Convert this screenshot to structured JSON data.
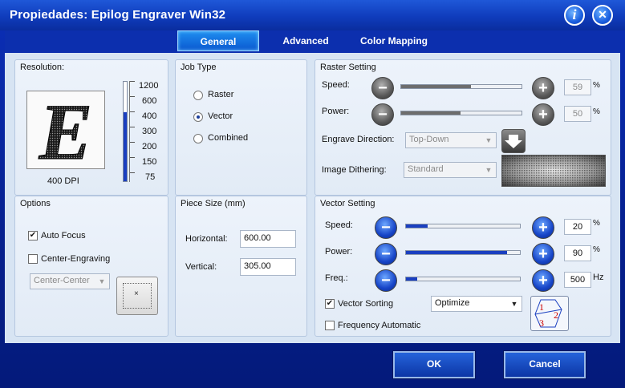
{
  "window": {
    "title": "Propiedades: Epilog Engraver Win32"
  },
  "title_buttons": {
    "info": "i",
    "close": "✕"
  },
  "tabs": [
    {
      "label": "General"
    },
    {
      "label": "Advanced"
    },
    {
      "label": "Color Mapping"
    }
  ],
  "resolution": {
    "title": "Resolution:",
    "preview_letter": "E",
    "dpi_label": "400 DPI",
    "scale": [
      "1200",
      "600",
      "400",
      "300",
      "200",
      "150",
      "75"
    ],
    "selected": "400"
  },
  "job_type": {
    "title": "Job Type",
    "options": [
      "Raster",
      "Vector",
      "Combined"
    ],
    "selected": "Vector"
  },
  "raster": {
    "title": "Raster Setting",
    "speed_label": "Speed:",
    "speed_value": "59",
    "speed_unit": "%",
    "power_label": "Power:",
    "power_value": "50",
    "power_unit": "%",
    "engrave_direction_label": "Engrave Direction:",
    "engrave_direction": "Top-Down",
    "dithering_label": "Image Dithering:",
    "dithering": "Standard"
  },
  "options": {
    "title": "Options",
    "auto_focus_label": "Auto Focus",
    "auto_focus": true,
    "center_engraving_label": "Center-Engraving",
    "center_engraving": false,
    "center_mode": "Center-Center",
    "center_mark": "×"
  },
  "piece_size": {
    "title": "Piece Size (mm)",
    "horizontal_label": "Horizontal:",
    "horizontal": "600.00",
    "vertical_label": "Vertical:",
    "vertical": "305.00"
  },
  "vector": {
    "title": "Vector Setting",
    "speed_label": "Speed:",
    "speed_value": "20",
    "speed_unit": "%",
    "power_label": "Power:",
    "power_value": "90",
    "power_unit": "%",
    "freq_label": "Freq.:",
    "freq_value": "500",
    "freq_unit": "Hz",
    "vector_sorting_label": "Vector Sorting",
    "vector_sorting": true,
    "sort_mode": "Optimize",
    "frequency_automatic_label": "Frequency Automatic",
    "frequency_automatic": false,
    "sort_icon_numbers": [
      "1",
      "2",
      "3"
    ]
  },
  "buttons": {
    "ok": "OK",
    "cancel": "Cancel"
  },
  "controls": {
    "minus": "−",
    "plus": "+",
    "dropdown": "▼"
  },
  "colors": {
    "titlebar": "#1f58d8",
    "panel_bg": "#e7eef8",
    "accent_blue": "#1745c8",
    "active_tab": "#1f8ef0"
  }
}
